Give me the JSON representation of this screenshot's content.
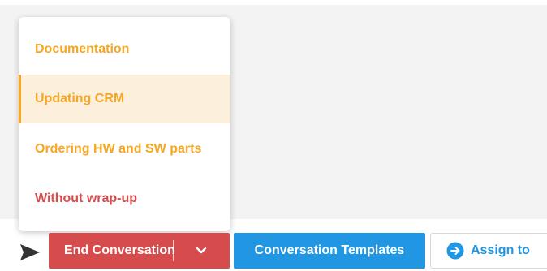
{
  "wrapup_menu": {
    "items": [
      {
        "label": "Documentation",
        "color": "#f5a623",
        "active": false
      },
      {
        "label": "Updating CRM",
        "color": "#f5a623",
        "active": true
      },
      {
        "label": "Ordering HW and SW parts",
        "color": "#f5a623",
        "active": false
      },
      {
        "label": "Without wrap-up",
        "color": "#d64b4b",
        "active": false
      }
    ],
    "active_background": "#fcefdc"
  },
  "toolbar": {
    "send_icon": "send-icon",
    "end_conversation_label": "End Conversation",
    "end_conversation_color": "#d64b4b",
    "dropdown_icon": "chevron-down-icon",
    "templates_label": "Conversation Templates",
    "templates_color": "#2196e3",
    "assign_label": "Assign to",
    "assign_icon": "arrow-right-circle-icon"
  }
}
